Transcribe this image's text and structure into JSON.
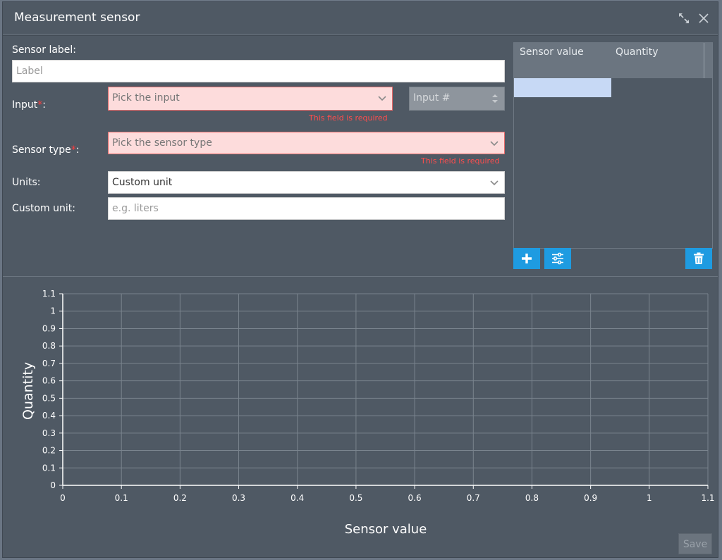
{
  "dialog": {
    "title": "Measurement sensor"
  },
  "form": {
    "sensor_label": {
      "label": "Sensor label:",
      "placeholder": "Label"
    },
    "input": {
      "label": "Input",
      "suffix": ":",
      "placeholder": "Pick the input",
      "error": "This field is required",
      "number_placeholder": "Input #"
    },
    "sensor_type": {
      "label": "Sensor type",
      "suffix": ":",
      "placeholder": "Pick the sensor type",
      "error": "This field is required"
    },
    "units": {
      "label": "Units:",
      "value": "Custom unit"
    },
    "custom_unit": {
      "label": "Custom unit:",
      "placeholder": "e.g. liters"
    },
    "required_mark": "*"
  },
  "table": {
    "columns": [
      "Sensor value",
      "Quantity"
    ]
  },
  "toolbar": {
    "add_icon": "plus-icon",
    "settings_icon": "sliders-icon",
    "delete_icon": "trash-icon"
  },
  "chart_data": {
    "type": "line",
    "series": [],
    "xlabel": "Sensor value",
    "ylabel": "Quantity",
    "xlim": [
      0,
      1.1
    ],
    "ylim": [
      0,
      1.1
    ],
    "xticks": [
      "0",
      "0.1",
      "0.2",
      "0.3",
      "0.4",
      "0.5",
      "0.6",
      "0.7",
      "0.8",
      "0.9",
      "1",
      "1.1"
    ],
    "yticks": [
      "0",
      "0.1",
      "0.2",
      "0.3",
      "0.4",
      "0.5",
      "0.6",
      "0.7",
      "0.8",
      "0.9",
      "1",
      "1.1"
    ],
    "grid": true
  },
  "footer": {
    "save_label": "Save"
  },
  "colors": {
    "background": "#4f5964",
    "accent": "#1e9be1",
    "error": "#ff4d4d",
    "error_field": "#fddcdc"
  }
}
